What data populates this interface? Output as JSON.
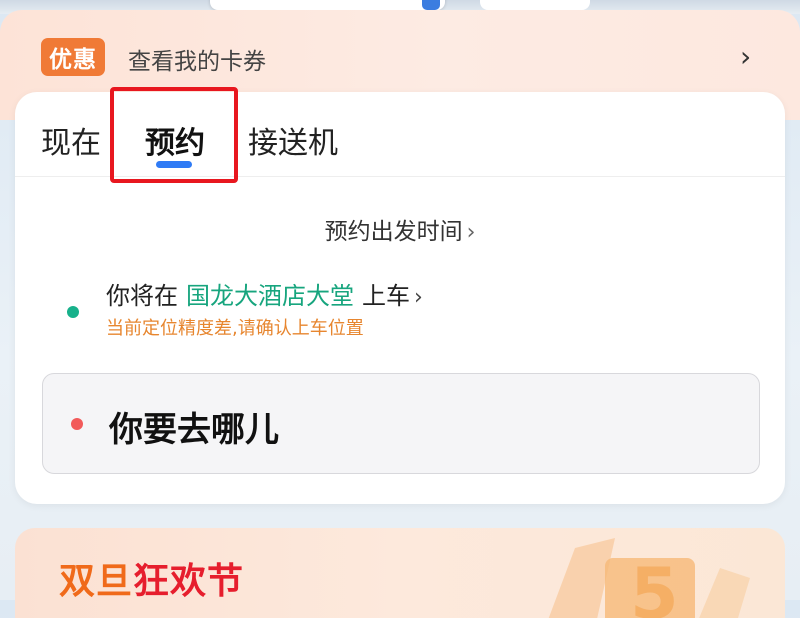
{
  "coupon": {
    "badge": "优惠",
    "text": "查看我的卡券",
    "arrow": "›"
  },
  "tabs": [
    {
      "label": "现在",
      "active": false
    },
    {
      "label": "预约",
      "active": true
    },
    {
      "label": "接送机",
      "active": false
    }
  ],
  "reservation": {
    "time_label": "预约出发时间",
    "time_chevron": "›"
  },
  "pickup": {
    "prefix": "你将在",
    "location": "国龙大酒店大堂",
    "suffix": "上车",
    "chevron": "›",
    "warning": "当前定位精度差,请确认上车位置"
  },
  "destination": {
    "placeholder": "你要去哪儿"
  },
  "promo": {
    "title_part1": "双旦",
    "title_part2": "狂欢节"
  },
  "colors": {
    "accent_blue": "#2f7bf5",
    "pickup_green": "#17a57e",
    "warning_orange": "#e7862f",
    "dest_red": "#f25a5a",
    "coupon_orange": "#f07a36",
    "highlight_red": "#e8171f"
  }
}
